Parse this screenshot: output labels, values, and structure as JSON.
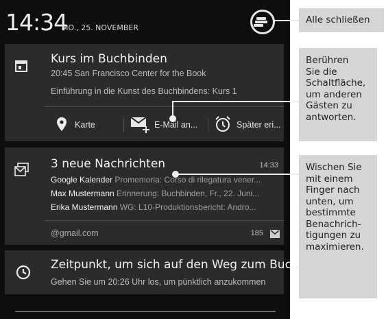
{
  "statusbar": {
    "time": "14:34",
    "date": "MO., 25. NOVEMBER"
  },
  "event": {
    "title": "Kurs im Buchbinden",
    "when_where": "20:45 San Francisco Center for the Book",
    "description": "Einführung in die Kunst des Buchbindens: Kurs 1",
    "actions": [
      {
        "label": "Karte",
        "icon": "map-pin-icon"
      },
      {
        "label": "E-Mail an...",
        "icon": "email-add-icon"
      },
      {
        "label": "Später eri...",
        "icon": "alarm-clock-icon"
      }
    ]
  },
  "gmail": {
    "title": "3 neue Nachrichten",
    "time": "14:33",
    "messages": [
      {
        "sender": "Google Kalender",
        "preview": "Promemoria: Corso di rilegatura vener..."
      },
      {
        "sender": "Max Mustermann",
        "preview": "Erinnerung: Buchbinden, Fr., 22. Juni..."
      },
      {
        "sender": "Erika Mustermann",
        "preview": "WG: L10-Produktionsbericht: Andro..."
      }
    ],
    "account": "@gmail.com",
    "count": "185"
  },
  "reminder": {
    "title": "Zeitpunkt, um sich auf den Weg zum Buc...",
    "subtitle": "Gehen Sie um 20:26 Uhr los, um pünktlich anzukommen"
  },
  "callouts": {
    "clear_all": "Alle schließen",
    "tap_button": "Berühren\nSie die\nSchaltfläche,\num anderen\nGästen zu\nantworten.",
    "swipe": "Wischen Sie\nmit einem\nFinger nach\nunten, um\nbestimmte\nBenachrich-\ntigungen zu\nmaximieren."
  },
  "colors": {
    "background": "#0e0e0e",
    "card": "#2b2b2b",
    "callout": "#d5d5d5"
  }
}
